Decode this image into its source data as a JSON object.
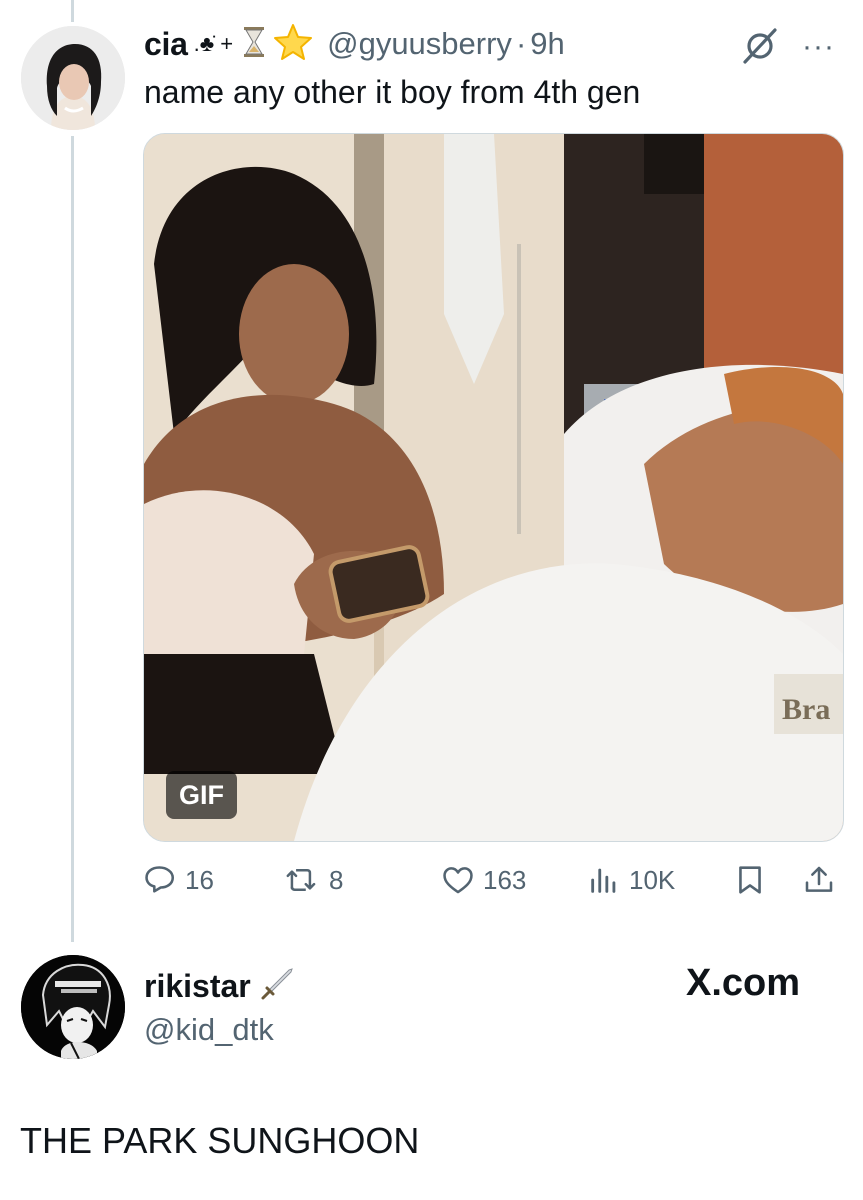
{
  "tweet": {
    "display_name": "cia",
    "name_decorations": ".♣̇ +",
    "handle": "@gyuusberry",
    "separator": "·",
    "time": "9h",
    "text": "name any other it boy from 4th gen",
    "media_badge": "GIF",
    "media_overlay_text": "Bra",
    "stats": {
      "replies": "16",
      "reposts": "8",
      "likes": "163",
      "views": "10K"
    }
  },
  "reply": {
    "display_name": "rikistar",
    "handle": "@kid_dtk",
    "text": "THE PARK SUNGHOON"
  },
  "brand": "X.com",
  "icons": {
    "more": "···",
    "names": [
      "reply-icon",
      "retweet-icon",
      "like-icon",
      "views-icon",
      "bookmark-icon",
      "share-icon",
      "grok-icon",
      "more-icon",
      "hourglass-icon",
      "star-icon",
      "sword-icon"
    ]
  },
  "colors": {
    "secondary_text": "#536471",
    "thread_line": "#cfd9de",
    "star": "#f4b400"
  }
}
